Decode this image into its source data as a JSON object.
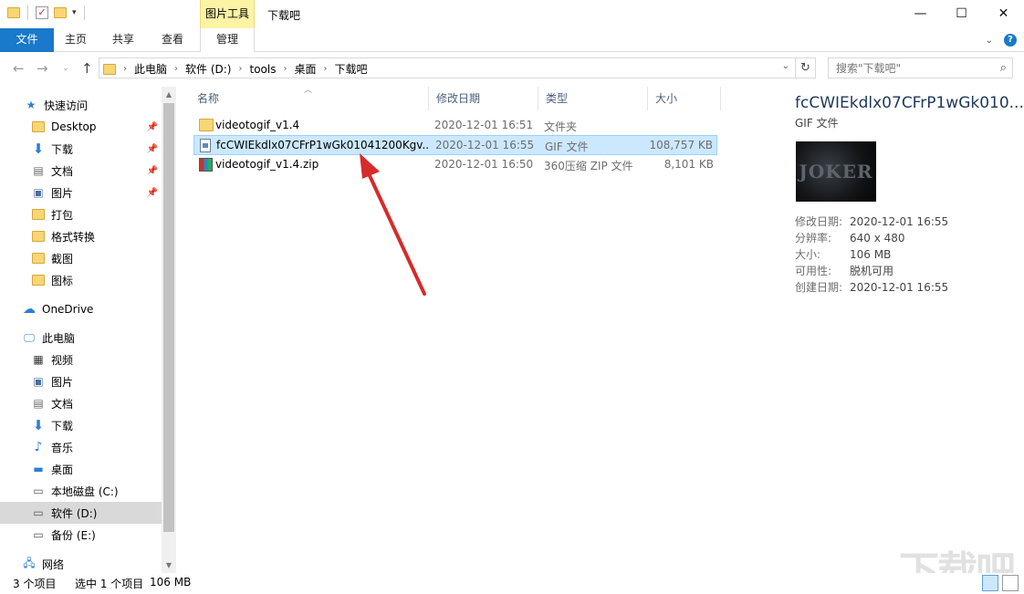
{
  "title_bar": {
    "context_tab_group": "图片工具",
    "window_title": "下载吧",
    "minimize": "—",
    "maximize": "☐",
    "close": "✕"
  },
  "ribbon": {
    "tabs": [
      "文件",
      "主页",
      "共享",
      "查看",
      "管理"
    ],
    "help": "?"
  },
  "address": {
    "crumbs": [
      "此电脑",
      "软件 (D:)",
      "tools",
      "桌面",
      "下载吧"
    ],
    "search_placeholder": "搜索\"下载吧\""
  },
  "nav": {
    "quick_access": "快速访问",
    "quick_items": [
      "Desktop",
      "下载",
      "文档",
      "图片",
      "打包",
      "格式转换",
      "截图",
      "图标"
    ],
    "onedrive": "OneDrive",
    "this_pc": "此电脑",
    "pc_items": [
      "视频",
      "图片",
      "文档",
      "下载",
      "音乐",
      "桌面",
      "本地磁盘 (C:)",
      "软件 (D:)",
      "备份 (E:)"
    ],
    "network": "网络"
  },
  "columns": [
    "名称",
    "修改日期",
    "类型",
    "大小"
  ],
  "files": [
    {
      "name": "videotogif_v1.4",
      "date": "2020-12-01 16:51",
      "type": "文件夹",
      "size": ""
    },
    {
      "name": "fcCWIEkdlx07CFrP1wGk01041200Kgv...",
      "date": "2020-12-01 16:55",
      "type": "GIF 文件",
      "size": "108,757 KB"
    },
    {
      "name": "videotogif_v1.4.zip",
      "date": "2020-12-01 16:50",
      "type": "360压缩 ZIP 文件",
      "size": "8,101 KB"
    }
  ],
  "details": {
    "title": "fcCWIEkdlx07CFrP1wGk010...",
    "type": "GIF 文件",
    "thumb_text": "JOKER",
    "props": [
      {
        "k": "修改日期:",
        "v": "2020-12-01 16:55"
      },
      {
        "k": "分辨率:",
        "v": "640 x 480"
      },
      {
        "k": "大小:",
        "v": "106 MB"
      },
      {
        "k": "可用性:",
        "v": "脱机可用"
      },
      {
        "k": "创建日期:",
        "v": "2020-12-01 16:55"
      }
    ]
  },
  "status": {
    "count": "3 个项目",
    "selected": "选中 1 个项目",
    "selected_size": "106 MB"
  },
  "watermark": "下载吧",
  "colors": {
    "accent": "#1979ca",
    "selection": "#cce8ff",
    "context_tab": "#fdf3a4",
    "arrow": "#d62b2b"
  }
}
